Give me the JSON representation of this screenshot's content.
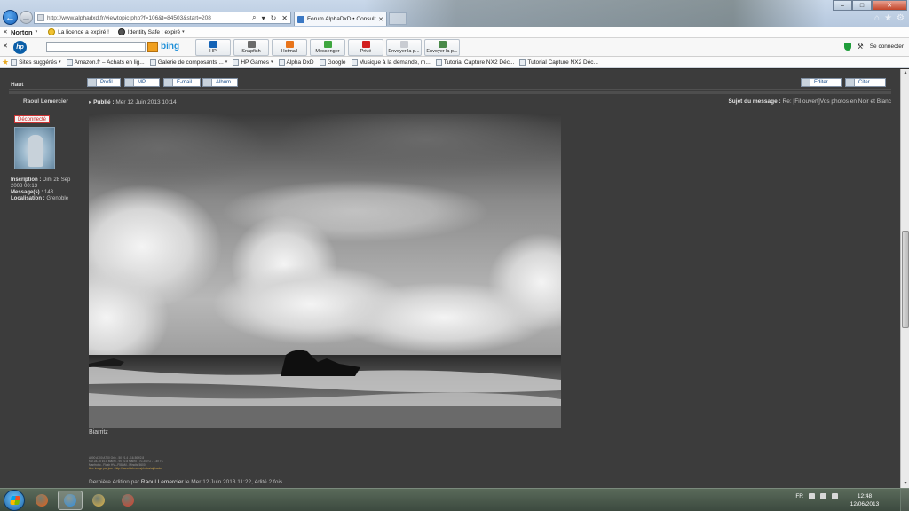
{
  "browser": {
    "url": "http://www.alphadxd.fr/viewtopic.php?f=106&t=84503&start=208",
    "tab_title": "Forum AlphaDxD • Consult...",
    "window_controls": [
      "minimize",
      "maximize",
      "close"
    ]
  },
  "norton_bar": {
    "brand": "Norton",
    "license": "La licence a expiré !",
    "identity": "Identity Safe : expiré"
  },
  "hp_bar": {
    "logo": "hp",
    "search_placeholder": "",
    "bing": "bing",
    "tiles": [
      {
        "label": "HP",
        "icon": "hp-icon",
        "color": "#1463b6"
      },
      {
        "label": "Snapfish",
        "icon": "snapfish-icon",
        "color": "#6b6b6b"
      },
      {
        "label": "Hotmail",
        "icon": "hotmail-icon",
        "color": "#e8741b"
      },
      {
        "label": "Messenger",
        "icon": "messenger-icon",
        "color": "#3fa63f"
      },
      {
        "label": "Privé",
        "icon": "private-icon",
        "color": "#d22020"
      },
      {
        "label": "Envoyer la p...",
        "icon": "send-page-icon",
        "color": "#c9ccd2"
      },
      {
        "label": "Envoyer la p...",
        "icon": "send-page-icon",
        "color": "#4a8a4a"
      }
    ],
    "connect": "Se connecter"
  },
  "favorites": [
    {
      "label": "Sites suggérés",
      "icon": "suggested-sites-icon",
      "caret": true
    },
    {
      "label": "Amazon.fr – Achats en lig...",
      "icon": "amazon-icon",
      "caret": false
    },
    {
      "label": "Galerie de composants ...",
      "icon": "gallery-icon",
      "caret": true
    },
    {
      "label": "HP Games",
      "icon": "hp-games-icon",
      "caret": true
    },
    {
      "label": "Alpha DxD",
      "icon": "alphadxd-icon",
      "caret": false
    },
    {
      "label": "Google",
      "icon": "google-icon",
      "caret": false
    },
    {
      "label": "Musique à la demande, m...",
      "icon": "music-icon",
      "caret": false
    },
    {
      "label": "Tutorial Capture NX2  Déc...",
      "icon": "tutorial-icon",
      "caret": false
    },
    {
      "label": "Tutorial Capture NX2  Déc...",
      "icon": "tutorial-icon",
      "caret": false
    }
  ],
  "forum": {
    "top_link": "Haut",
    "buttons_left": [
      "Profil",
      "MP",
      "E-mail",
      "Album"
    ],
    "buttons_right": [
      "Editer",
      "Citer"
    ],
    "author": "Raoul Lemercier",
    "status": "Déconnecté",
    "published_label": "Publié :",
    "published_date": "Mer 12 Juin 2013 10:14",
    "subject_label": "Sujet du message :",
    "subject_value": "Re: [Fil ouvert]Vos photos en Noir et Blanc",
    "profile": {
      "inscription_label": "Inscription :",
      "inscription_value": "Dim 28 Sep 2008 00:13",
      "messages_label": "Message(s) :",
      "messages_value": "143",
      "location_label": "Localisation :",
      "location_value": "Grenoble"
    },
    "caption": "Biarritz",
    "signature_lines": [
      "A900 A700 A700 Grip - 50 f/1.4 - 16-50 f/2.8",
      "KM 28-75 f/2.8 Macro - 90 f/2.8 Macro - 70-300 G - 1.4x TC",
      "Manfrotto - Flash HVL-F58AM - Minolta 5600",
      "Une image par jour : http://www.flickr.com/photos/alphadxd"
    ],
    "signature_link": "http://www.flickr.com/photos/alphadxd",
    "edited_prefix": "Dernière édition par",
    "edited_author": "Raoul Lemercier",
    "edited_suffix": "le Mer 12 Juin 2013 11:22, édité 2 fois."
  },
  "taskbar": {
    "apps": [
      {
        "name": "media-player-icon",
        "color": "#e8641b"
      },
      {
        "name": "internet-explorer-icon",
        "color": "#2e8fe0"
      },
      {
        "name": "file-explorer-icon",
        "color": "#e3b84a"
      },
      {
        "name": "chrome-icon",
        "color": "#d9442f"
      }
    ],
    "language": "FR",
    "time": "12:48",
    "date": "12/06/2013"
  }
}
